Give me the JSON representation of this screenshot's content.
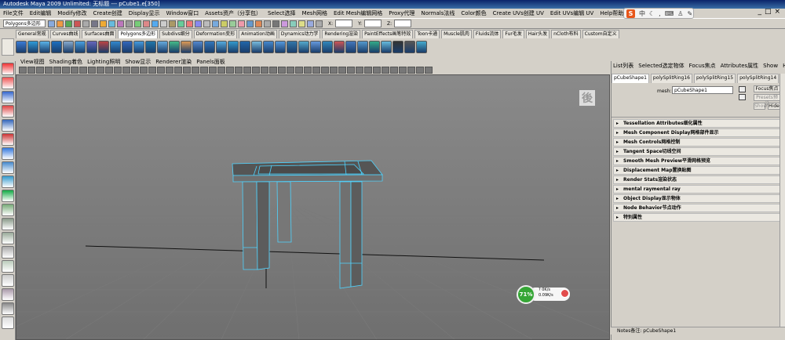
{
  "window": {
    "title": "Autodesk Maya 2009 Unlimited: 无标题   ---   pCube1.e[350]",
    "ime_label": "中",
    "controls": [
      "_",
      "□",
      "×"
    ]
  },
  "menubar": [
    "File文件",
    "Edit编辑",
    "Modify修改",
    "Create创建",
    "Display显示",
    "Window窗口",
    "Assets资产（分享包）",
    "Select选择",
    "Mesh网格",
    "Edit Mesh编辑网格",
    "Proxy代理",
    "Normals法线",
    "Color颜色",
    "Create UVs创建 UV",
    "Edit UVs编辑 UV",
    "Help帮助"
  ],
  "statusline": {
    "mode": "Polygons多边形",
    "x_label": "X:",
    "y_label": "Y:",
    "z_label": "Z:"
  },
  "shelf_tabs": [
    "General常规",
    "Curves曲线",
    "Surfaces曲面",
    "Polygons多边形",
    "Subdivs细分",
    "Deformation变形",
    "Animation动画",
    "Dynamics动力学",
    "Rendering渲染",
    "PaintEffects画笔特效",
    "Toon卡通",
    "Muscle肌肉",
    "Fluids流体",
    "Fur毛发",
    "Hair头发",
    "nCloth布料",
    "Custom自定义"
  ],
  "shelf_active": "Polygons多边形",
  "panel_menu": [
    "View视图",
    "Shading着色",
    "Lighting照明",
    "Show显示",
    "Renderer渲染",
    "Panels面板"
  ],
  "viewport": {
    "viewcube_label": "後",
    "perf": {
      "percent": "71%",
      "up": "?",
      "up_label": "0K/s",
      "down": "0.09K/s"
    }
  },
  "attribute_editor": {
    "menu": [
      "List列表",
      "Selected选定物体",
      "Focus焦点",
      "Attributes属性",
      "Show",
      "Help帮助"
    ],
    "tabs": [
      "pCubeShape1",
      "polySplitRing16",
      "polySplitRing15",
      "polySplitRing14",
      "polySplitR"
    ],
    "mesh_label": "mesh:",
    "mesh_value": "pCubeShape1",
    "buttons": {
      "focus": "Focus焦点",
      "presets": "Presets预设",
      "show": "Show",
      "hide": "Hide"
    },
    "sections": [
      "Tessellation Attributes细化属性",
      "Mesh Component Display网格部件显示",
      "Mesh Controls网格控制",
      "Tangent Space切线空间",
      "Smooth Mesh Preview平滑网格预览",
      "Displacement Map置换贴图",
      "Render Stats渲染状态",
      "mental raymental ray",
      "Object Display显示物体",
      "Node Behavior节点动作",
      "特别属性"
    ],
    "notes": "Notes备注: pCubeShape1"
  }
}
